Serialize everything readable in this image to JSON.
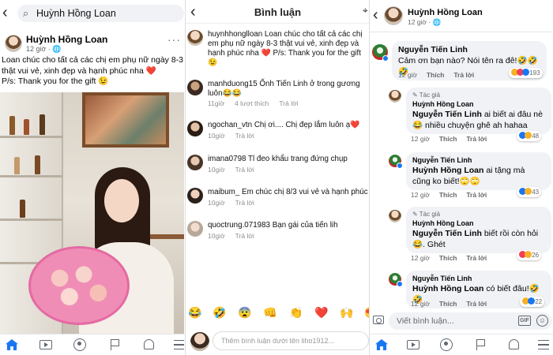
{
  "panel1": {
    "search_text": "Huỳnh Hồng Loan",
    "post": {
      "author": "Huỳnh Hồng Loan",
      "time": "12 giờ",
      "privacy_icon": "globe-icon",
      "text_line1": "Loan chúc cho tất cả các chị em phụ nữ ngày 8-3 thật vui vẻ, xinh đẹp và hạnh phúc nha ❤️",
      "text_line2": "P/s: Thank you for the gift 😉"
    },
    "nav_icons": [
      "home-icon",
      "video-icon",
      "groups-icon",
      "flag-icon",
      "bell-icon",
      "menu-icon"
    ],
    "accent_color": "#1877f2"
  },
  "panel2": {
    "title": "Bình luận",
    "comments": [
      {
        "user": "huynhhonglloan",
        "text": "Loan chúc cho tất cả các chị em phụ nữ ngày 8-3 thật vui vẻ, xinh đẹp và hạnh phúc nha ❤️ P/s: Thank you for the gift 😉",
        "time": "",
        "likes": "",
        "reply": ""
      },
      {
        "user": "manhduong15",
        "text": "Ốnh Tiến Linh ở trong gương luôn😂😂",
        "time": "11giờ",
        "likes": "4 lượt thích",
        "reply": "Trả lời"
      },
      {
        "user": "ngochan_vtn",
        "text": "Chị ơi.... Chị đẹp lắm luôn ạ❤️",
        "time": "10giờ",
        "likes": "",
        "reply": "Trả lời"
      },
      {
        "user": "imana0798",
        "text": "Tl đeo khẩu trang đứng chụp",
        "time": "10giờ",
        "likes": "",
        "reply": "Trả lời"
      },
      {
        "user": "maibum_",
        "text": "Em chúc chị 8/3 vui vẻ và hạnh phúc",
        "time": "10giờ",
        "likes": "",
        "reply": "Trả lời"
      },
      {
        "user": "quoctrung.071983",
        "text": "Bạn gái của tiến lih",
        "time": "10giờ",
        "likes": "",
        "reply": "Trả lời"
      }
    ],
    "emoji_bar": [
      "😂",
      "🤣",
      "😨",
      "👊",
      "👏",
      "❤️",
      "🙌",
      "😍"
    ],
    "input_placeholder": "Thêm bình luận dưới tên liho1912..."
  },
  "panel3": {
    "header_name": "Huỳnh Hồng Loan",
    "header_time": "12 giờ",
    "threads": [
      {
        "name": "Nguyễn Tiến Linh",
        "text": "Cảm ơn bạn nào? Nói tên ra đê!🤣🤣🤣",
        "time": "12 giờ",
        "like": "Thích",
        "reply": "Trả lời",
        "reactions": "193"
      },
      {
        "tag": "Tác giả",
        "author": "Huỳnh Hồng Loan",
        "mention": "Nguyễn Tiến Linh",
        "text": "ai biết ai đâu nè 😂 nhiều chuyện ghê ah hahaa",
        "time": "12 giờ",
        "like": "Thích",
        "reply": "Trả lời",
        "reactions": "48"
      },
      {
        "author": "Nguyễn Tiến Linh",
        "mention": "Huỳnh Hồng Loan",
        "text": "ai tặng mà cũng ko biết!🙄🙄",
        "time": "12 giờ",
        "like": "Thích",
        "reply": "Trả lời",
        "reactions": "43"
      },
      {
        "tag": "Tác giả",
        "author": "Huỳnh Hồng Loan",
        "mention": "Nguyễn Tiến Linh",
        "text": "biết rồi còn hỏi 😂. Ghét",
        "time": "12 giờ",
        "like": "Thích",
        "reply": "Trả lời",
        "reactions": "26"
      },
      {
        "author": "Nguyễn Tiến Linh",
        "mention": "Huỳnh Hồng Loan",
        "text": "có biết đâu!🤣🤣",
        "time": "12 giờ",
        "like": "Thích",
        "reply": "Trả lời",
        "reactions": "22"
      }
    ],
    "write_placeholder": "Viết bình luận...",
    "gif_label": "GIF"
  }
}
